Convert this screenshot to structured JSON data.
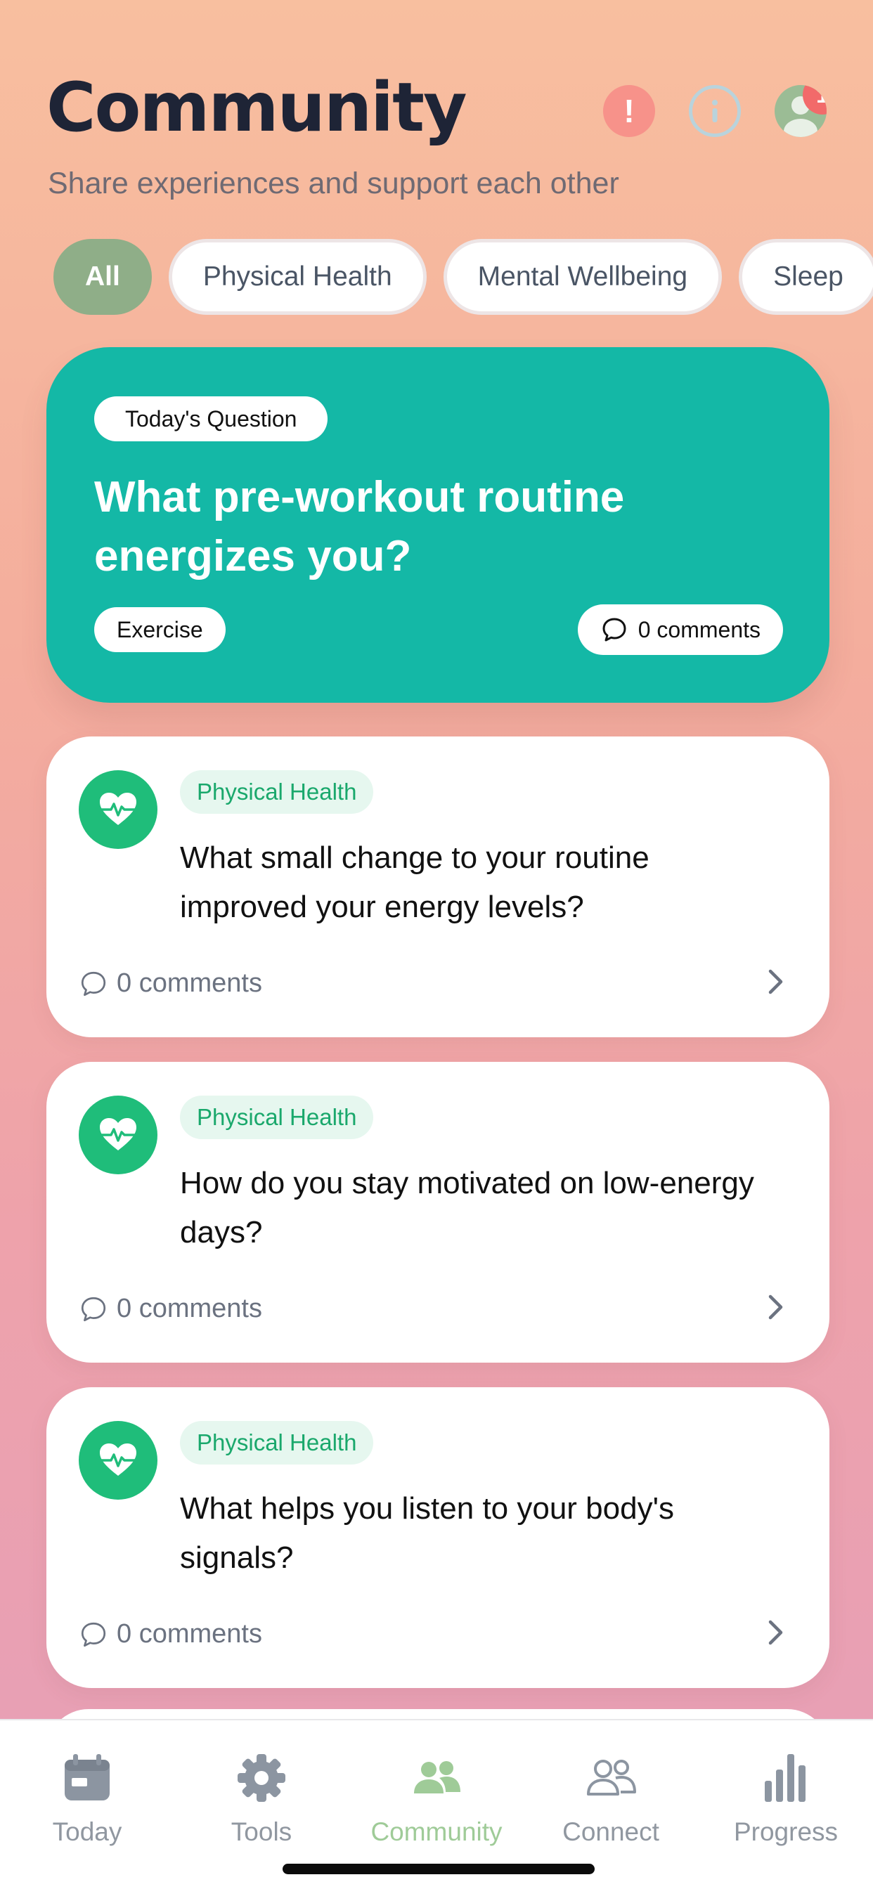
{
  "header": {
    "title": "Community",
    "subtitle": "Share experiences and support each other",
    "alert_glyph": "!",
    "notification_count": "1"
  },
  "filters": [
    "All",
    "Physical Health",
    "Mental Wellbeing",
    "Sleep"
  ],
  "featured": {
    "label": "Today's Question",
    "question": "What pre-workout routine energizes you?",
    "tag": "Exercise",
    "comments": "0 comments",
    "background": "#14b8a6"
  },
  "questions": [
    {
      "category": "Physical Health",
      "text": "What small change to your routine improved your energy levels?",
      "comments": "0 comments",
      "icon": "heart-pulse-icon"
    },
    {
      "category": "Physical Health",
      "text": "How do you stay motivated on low-energy days?",
      "comments": "0 comments",
      "icon": "heart-pulse-icon"
    },
    {
      "category": "Physical Health",
      "text": "What helps you listen to your body's signals?",
      "comments": "0 comments",
      "icon": "heart-pulse-icon"
    }
  ],
  "tabs": [
    {
      "label": "Today",
      "icon": "calendar-icon",
      "active": false
    },
    {
      "label": "Tools",
      "icon": "gear-icon",
      "active": false
    },
    {
      "label": "Community",
      "icon": "people-icon",
      "active": true
    },
    {
      "label": "Connect",
      "icon": "people-outline-icon",
      "active": false
    },
    {
      "label": "Progress",
      "icon": "bar-chart-icon",
      "active": false
    }
  ],
  "colors": {
    "accent_green": "#1fbd7a",
    "active_chip": "#8fae88",
    "active_tab": "#9fcb98",
    "badge": "#f26a6a"
  }
}
